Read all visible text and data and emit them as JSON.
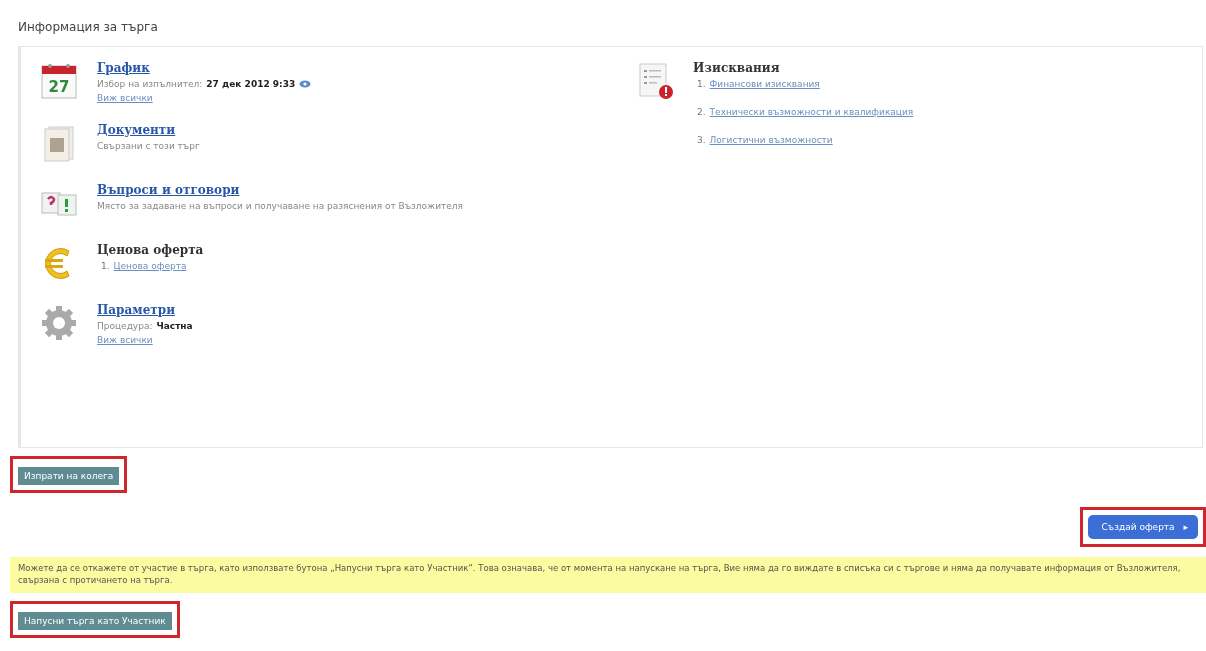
{
  "title": "Информация за търга",
  "sections": [
    {
      "kind": "calendar",
      "icon_text": "27",
      "title": "График",
      "link": true,
      "lines": [
        {
          "label": "Избор на изпълнител:",
          "value": "27 дек 2012 9:33",
          "info": true
        }
      ],
      "more": "Виж всички"
    },
    {
      "kind": "document",
      "title": "Документи",
      "link": true,
      "lines": [
        {
          "label": "Свързани с този търг"
        }
      ]
    },
    {
      "kind": "qa",
      "title": "Въпроси и отговори",
      "link": true,
      "lines": [
        {
          "label": "Място за задаване на въпроси и получаване на разяснения от Възложителя"
        }
      ]
    },
    {
      "kind": "euro",
      "title": "Ценова оферта",
      "link": false,
      "items": [
        {
          "number": "1.",
          "text": "Ценова оферта"
        }
      ]
    },
    {
      "kind": "gear",
      "title": "Параметри",
      "link": true,
      "lines": [
        {
          "label": "Процедура:",
          "value": "Частна"
        }
      ],
      "more": "Виж всички"
    }
  ],
  "requirements": {
    "title": "Изисквания",
    "items": [
      {
        "number": "1.",
        "text": "Финансови изисквания"
      },
      {
        "number": "2.",
        "text": "Технически възможности и квалификация"
      },
      {
        "number": "3.",
        "text": "Логистични възможности"
      }
    ]
  },
  "send_button": {
    "label": "Изпрати на колега",
    "highlighted": true
  },
  "create_button": {
    "label": "Създай оферта",
    "arrow": "▸",
    "highlighted": true
  },
  "notice": "Можете да се откажете от участие в търга, като използвате бутона „Напусни търга като Участник“. Това означава, че от момента на напускане на търга, Вие няма да го виждате в списъка си с търгове и няма да получавате информация от Възложителя, свързана с протичането на търга.",
  "leave_button": {
    "label": "Напусни търга като Участник",
    "highlighted": true
  }
}
